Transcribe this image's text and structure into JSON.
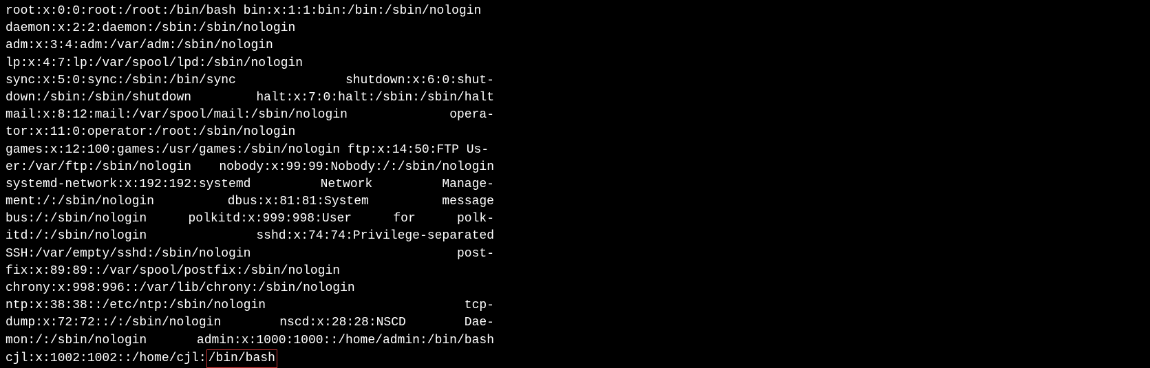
{
  "terminal": {
    "lines": [
      "root:x:0:0:root:/root:/bin/bash  bin:x:1:1:bin:/bin:/sbin/nologin",
      "daemon:x:2:2:daemon:/sbin:/sbin/nologin",
      "adm:x:3:4:adm:/var/adm:/sbin/nologin",
      "lp:x:4:7:lp:/var/spool/lpd:/sbin/nologin"
    ],
    "j1a": "sync:x:5:0:sync:/sbin:/bin/sync",
    "j1b": "shutdown:x:6:0:shut-",
    "j2a": "down:/sbin:/sbin/shutdown",
    "j2b": "halt:x:7:0:halt:/sbin:/sbin/halt",
    "j3a": "mail:x:8:12:mail:/var/spool/mail:/sbin/nologin",
    "j3b": "opera-",
    "l4": "tor:x:11:0:operator:/root:/sbin/nologin",
    "l5": "games:x:12:100:games:/usr/games:/sbin/nologin ftp:x:14:50:FTP Us-",
    "j6a": "er:/var/ftp:/sbin/nologin",
    "j6b": "nobody:x:99:99:Nobody:/:/sbin/nologin",
    "j7a": "systemd-network:x:192:192:systemd",
    "j7b": "Network",
    "j7c": "Manage-",
    "j8a": "ment:/:/sbin/nologin",
    "j8b": "dbus:x:81:81:System",
    "j8c": "message",
    "j9a": "bus:/:/sbin/nologin",
    "j9b": "polkitd:x:999:998:User",
    "j9c": "for",
    "j9d": "polk-",
    "j10a": "itd:/:/sbin/nologin",
    "j10b": "sshd:x:74:74:Privilege-separated",
    "j11a": "SSH:/var/empty/sshd:/sbin/nologin",
    "j11b": "post-",
    "l12": "fix:x:89:89::/var/spool/postfix:/sbin/nologin",
    "l13": "chrony:x:998:996::/var/lib/chrony:/sbin/nologin",
    "j14a": "ntp:x:38:38::/etc/ntp:/sbin/nologin",
    "j14b": "tcp-",
    "j15a": "dump:x:72:72::/:/sbin/nologin",
    "j15b": "nscd:x:28:28:NSCD",
    "j15c": "Dae-",
    "j16a": "mon:/:/sbin/nologin",
    "j16b": "admin:x:1000:1000::/home/admin:/bin/bash",
    "last_prefix": "cjl:x:1002:1002::/home/cjl:",
    "last_highlight": "/bin/bash"
  }
}
